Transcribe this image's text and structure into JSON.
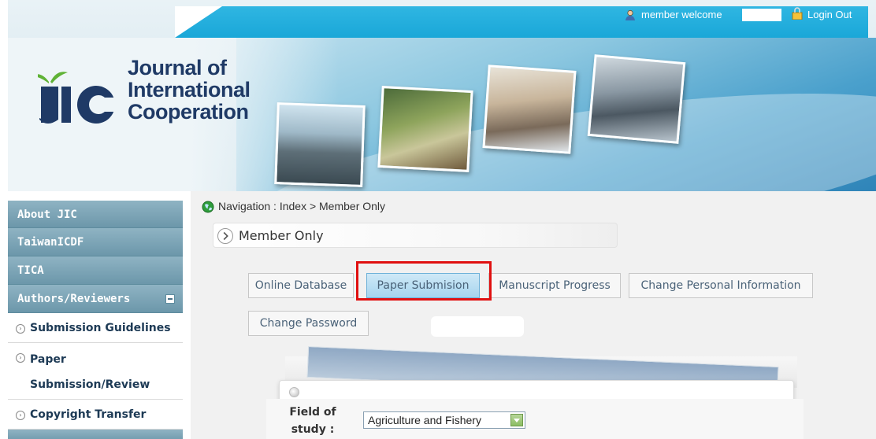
{
  "header": {
    "member_welcome": "member welcome",
    "logout": "Login Out",
    "logo": {
      "lines": [
        "Journal of",
        "International",
        "Cooperation"
      ],
      "mark_text": "JIC"
    }
  },
  "sidebar": {
    "items": [
      {
        "label": "About JIC"
      },
      {
        "label": "TaiwanICDF"
      },
      {
        "label": "TICA"
      },
      {
        "label": "Authors/Reviewers"
      }
    ],
    "subitems": [
      {
        "label": "Submission Guidelines"
      },
      {
        "label_line1": "Paper",
        "label_line2": "Submission/Review"
      },
      {
        "label": "Copyright Transfer"
      }
    ]
  },
  "main": {
    "navigation": "Navigation : Index > Member Only",
    "title": "Member Only",
    "tabs": [
      {
        "label": "Online Database"
      },
      {
        "label": "Paper Submision",
        "active": true
      },
      {
        "label": "Manuscript Progress"
      },
      {
        "label": "Change Personal Information"
      },
      {
        "label": "Change Password"
      }
    ],
    "form": {
      "field_label_line1": "Field of",
      "field_label_line2": "study :",
      "field_value": "Agriculture and Fishery"
    }
  },
  "colors": {
    "top_bar": "#1aa7d8",
    "sidebar_header": "#7ca3b5",
    "active_tab": "#a6d4ee",
    "highlight": "#e01010",
    "logo_text": "#1f3a66"
  },
  "icons": [
    "user-icon",
    "lock-icon",
    "globe-icon",
    "arrow-circle-icon",
    "collapse-icon",
    "bullet-icon",
    "dropdown-arrow-icon"
  ]
}
